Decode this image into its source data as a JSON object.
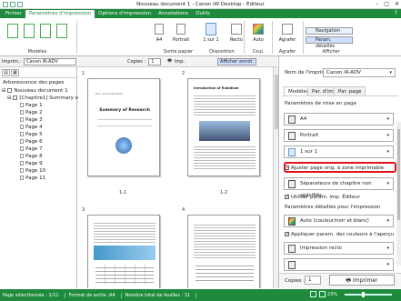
{
  "window": {
    "title": "Nouveau document 1 - Canon iW Desktop - Éditeur"
  },
  "menu": {
    "tabs": [
      "Fichier",
      "Paramètres d'impression",
      "Options d'impression",
      "Annotations",
      "Outils"
    ],
    "help": "?"
  },
  "ribbon": {
    "groups": {
      "modeles": "Modèles",
      "sortie": "Sortie papier",
      "disposition": "Disposition",
      "coul": "Coul.",
      "agrafer": "Agrafer",
      "afficher": "Afficher"
    },
    "buttons": {
      "a4": "A4",
      "portrait": "Portrait",
      "layout": "1 sur 1",
      "recto": "Recto",
      "auto": "Auto",
      "agrafer": "Agrafer",
      "navigation": "Navigation",
      "param_details": "Param. détaillés"
    }
  },
  "toolbar2": {
    "printer_label": "Imprim.:",
    "printer_value": "Canon iR-ADV",
    "copies_label": "Copies :",
    "copies_value": "1",
    "imp_label": "Imp.",
    "afficher_annot": "Afficher annot."
  },
  "leftpane": {
    "header": "Arborescence des pages",
    "root": "Nouveau document 1",
    "chapter": "[Chapitre1] Summary of F",
    "pages": [
      "Page 1",
      "Page 2",
      "Page 3",
      "Page 4",
      "Page 5",
      "Page 6",
      "Page 7",
      "Page 8",
      "Page 9",
      "Page 10",
      "Page 11"
    ]
  },
  "center": {
    "page_numbers": [
      "1",
      "2",
      "3",
      "4"
    ],
    "labels": [
      "1-1",
      "1-2"
    ],
    "thumb_titles": [
      "Summary of Research",
      "Introduction of Rubidium"
    ]
  },
  "rightpane": {
    "printer_name_label": "Nom de l'imprimante :",
    "printer_name_value": "Canon iR-ADV",
    "tabs": [
      "Modèles",
      "Par. d'imp.",
      "Par. page"
    ],
    "page_layout_title": "Paramètres de mise en page",
    "paper": "A4",
    "orientation": "Portrait",
    "layout": "1 sur 1",
    "fit_page": "Ajuster page orig. à zone imprimable",
    "chapter_sep": "Séparateurs de chapitre non spécifiés",
    "use_param": "Utiliser param. imp. Éditeur",
    "detail_title": "Paramètres détaillés pour l'impression",
    "color_mode": "Auto (couleur/noir et blanc)",
    "apply_preview": "Appliquer param. des couleurs à l'aperçu",
    "print_side": "Impression recto",
    "copies_label": "Copies :",
    "copies_value": "1",
    "print_button": "Imprimer"
  },
  "status": {
    "selected": "Page sélectionnée : 1/11",
    "format": "Format de sortie :A4",
    "total": "Nombre total de feuilles : 11",
    "zoom": "23%"
  },
  "colors": {
    "accent": "#1f8a3c",
    "highlight": "#e0141e"
  }
}
